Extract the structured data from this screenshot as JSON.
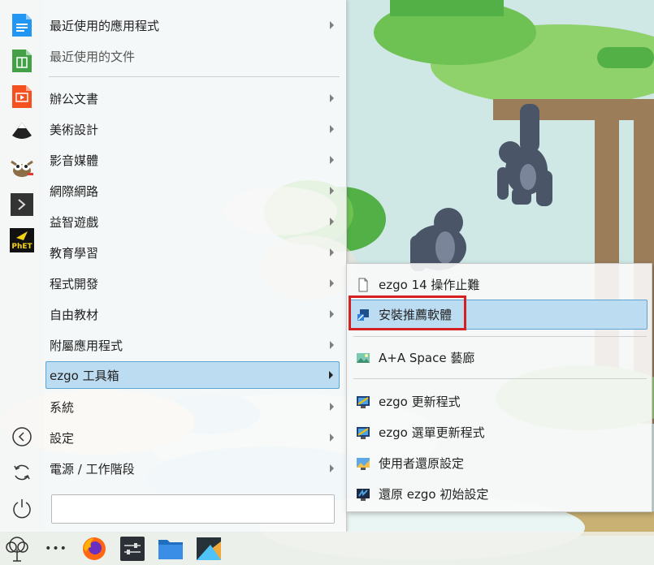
{
  "menu": {
    "items": [
      {
        "label": "最近使用的應用程式",
        "has_submenu": true
      },
      {
        "label": "最近使用的文件",
        "has_submenu": false
      },
      {
        "label": "辦公文書",
        "has_submenu": true
      },
      {
        "label": "美術設計",
        "has_submenu": true
      },
      {
        "label": "影音媒體",
        "has_submenu": true
      },
      {
        "label": "網際網路",
        "has_submenu": true
      },
      {
        "label": "益智遊戲",
        "has_submenu": true
      },
      {
        "label": "教育學習",
        "has_submenu": true
      },
      {
        "label": "程式開發",
        "has_submenu": true
      },
      {
        "label": "自由教材",
        "has_submenu": true
      },
      {
        "label": "附屬應用程式",
        "has_submenu": true
      },
      {
        "label": "ezgo 工具箱",
        "has_submenu": true,
        "selected": true
      },
      {
        "label": "系統",
        "has_submenu": true
      },
      {
        "label": "設定",
        "has_submenu": true
      },
      {
        "label": "電源 / 工作階段",
        "has_submenu": true
      }
    ],
    "search_value": "",
    "favorites": [
      "document-icon",
      "spreadsheet-icon",
      "presentation-icon",
      "inkscape-icon",
      "gimp-icon",
      "terminal-icon",
      "phet-icon"
    ],
    "phet_label": "PhET",
    "strip_buttons": [
      "back-icon",
      "refresh-icon",
      "power-icon"
    ]
  },
  "submenu": {
    "items": [
      {
        "label": "ezgo 14 操作止難",
        "icon": "document-icon"
      },
      {
        "label": "安裝推薦軟體",
        "icon": "install-icon",
        "hover": true
      },
      {
        "label": "A+A Space 藝廊",
        "icon": "image-icon"
      },
      {
        "label": "ezgo 更新程式",
        "icon": "update-icon"
      },
      {
        "label": "ezgo 選單更新程式",
        "icon": "update-icon"
      },
      {
        "label": "使用者還原設定",
        "icon": "restore-icon"
      },
      {
        "label": "還原 ezgo 初始設定",
        "icon": "reset-icon"
      }
    ]
  },
  "taskbar": {
    "items": [
      "app-launcher-icon",
      "more-icon",
      "firefox-icon",
      "settings-icon",
      "file-manager-icon",
      "software-center-icon"
    ],
    "more_label": "•••"
  },
  "colors": {
    "selection_bg": "#bcdcf2",
    "selection_border": "#5aa5d6",
    "highlight_red": "#d42020"
  }
}
